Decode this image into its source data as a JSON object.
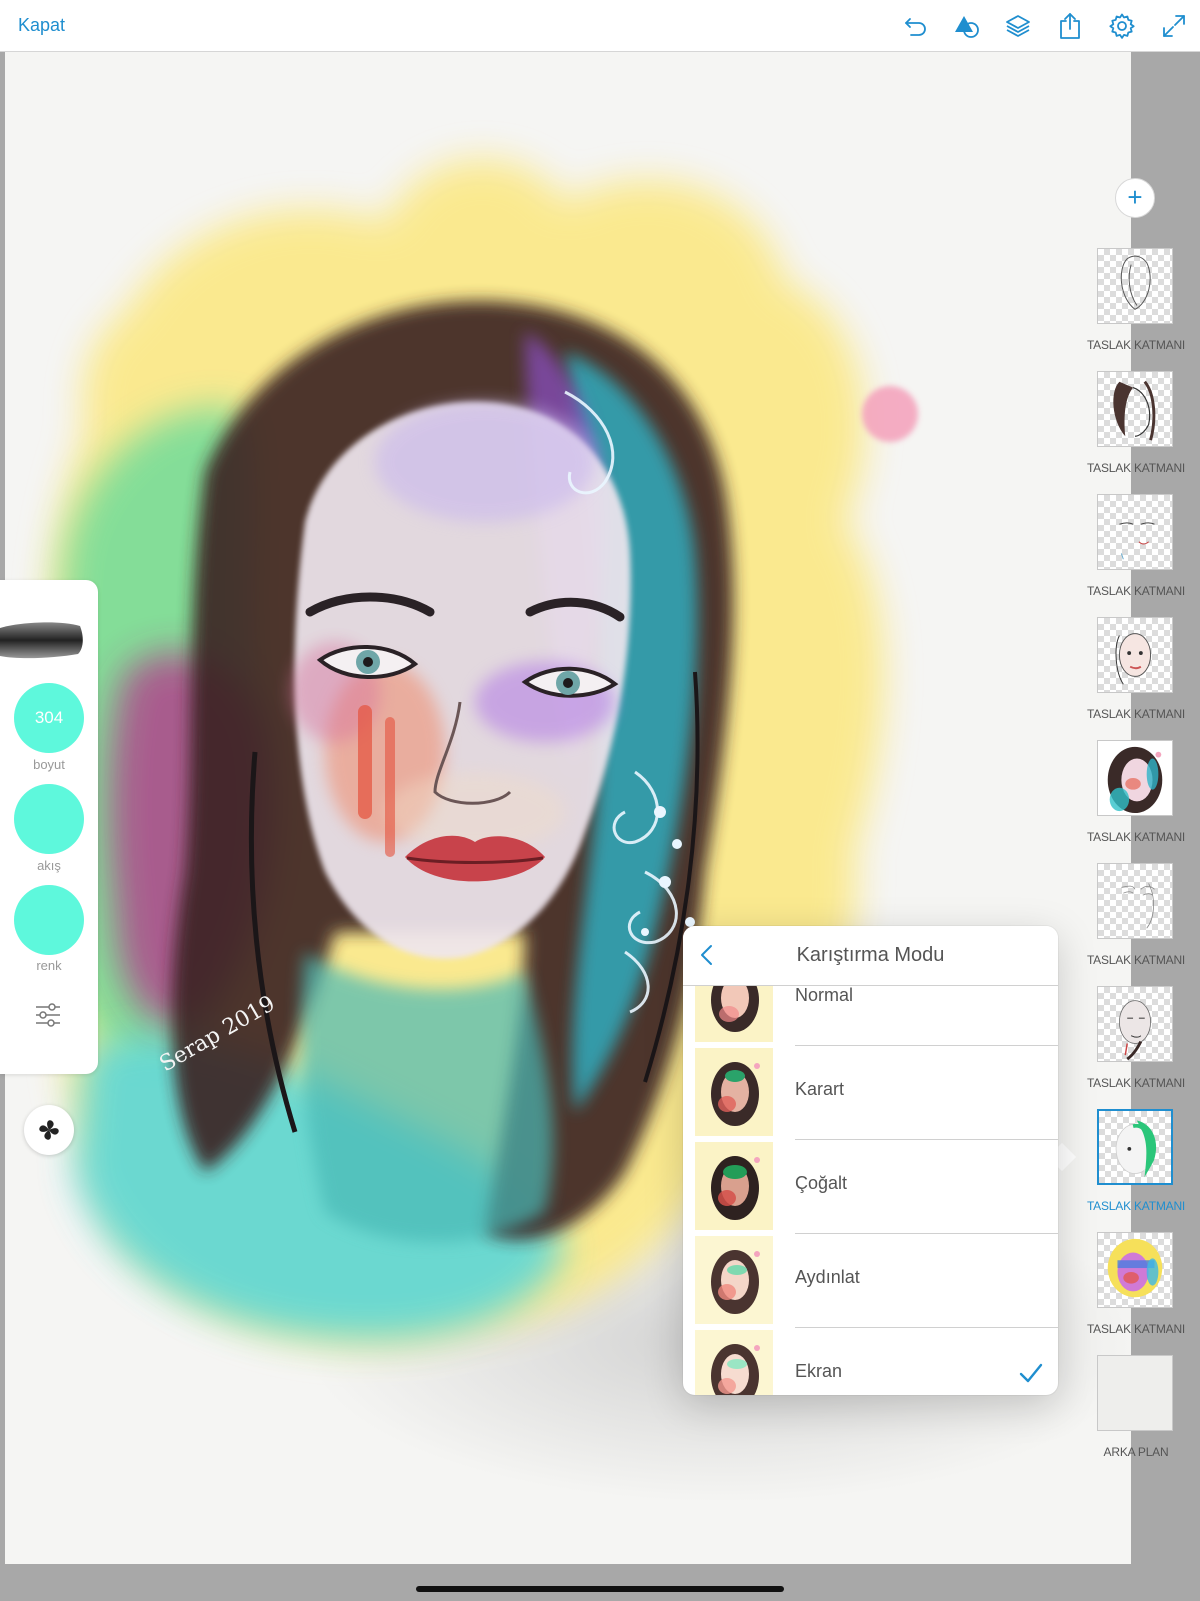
{
  "topbar": {
    "close_label": "Kapat",
    "icons": [
      "undo-icon",
      "shapes-icon",
      "layers-icon",
      "share-icon",
      "gear-icon",
      "fullscreen-icon"
    ]
  },
  "brush_panel": {
    "size_value": "304",
    "size_label": "boyut",
    "flow_label": "akış",
    "color_label": "renk",
    "accent_color": "#5ef8dc"
  },
  "layers": {
    "add_label": "+",
    "items": [
      {
        "label": "TASLAK KATMANI",
        "selected": false
      },
      {
        "label": "TASLAK KATMANI",
        "selected": false
      },
      {
        "label": "TASLAK KATMANI",
        "selected": false
      },
      {
        "label": "TASLAK KATMANI",
        "selected": false
      },
      {
        "label": "TASLAK KATMANI",
        "selected": false
      },
      {
        "label": "TASLAK KATMANI",
        "selected": false
      },
      {
        "label": "TASLAK KATMANI",
        "selected": false
      },
      {
        "label": "TASLAK KATMANI",
        "selected": true
      },
      {
        "label": "TASLAK KATMANI",
        "selected": false
      },
      {
        "label": "ARKA PLAN",
        "selected": false
      }
    ]
  },
  "blend_popover": {
    "title": "Karıştırma Modu",
    "modes": [
      {
        "label": "Normal",
        "checked": false
      },
      {
        "label": "Karart",
        "checked": false
      },
      {
        "label": "Çoğalt",
        "checked": false
      },
      {
        "label": "Aydınlat",
        "checked": false
      },
      {
        "label": "Ekran",
        "checked": true
      }
    ]
  },
  "colors": {
    "accent_blue": "#1f8ecf",
    "brush_teal": "#5ef8dc"
  }
}
